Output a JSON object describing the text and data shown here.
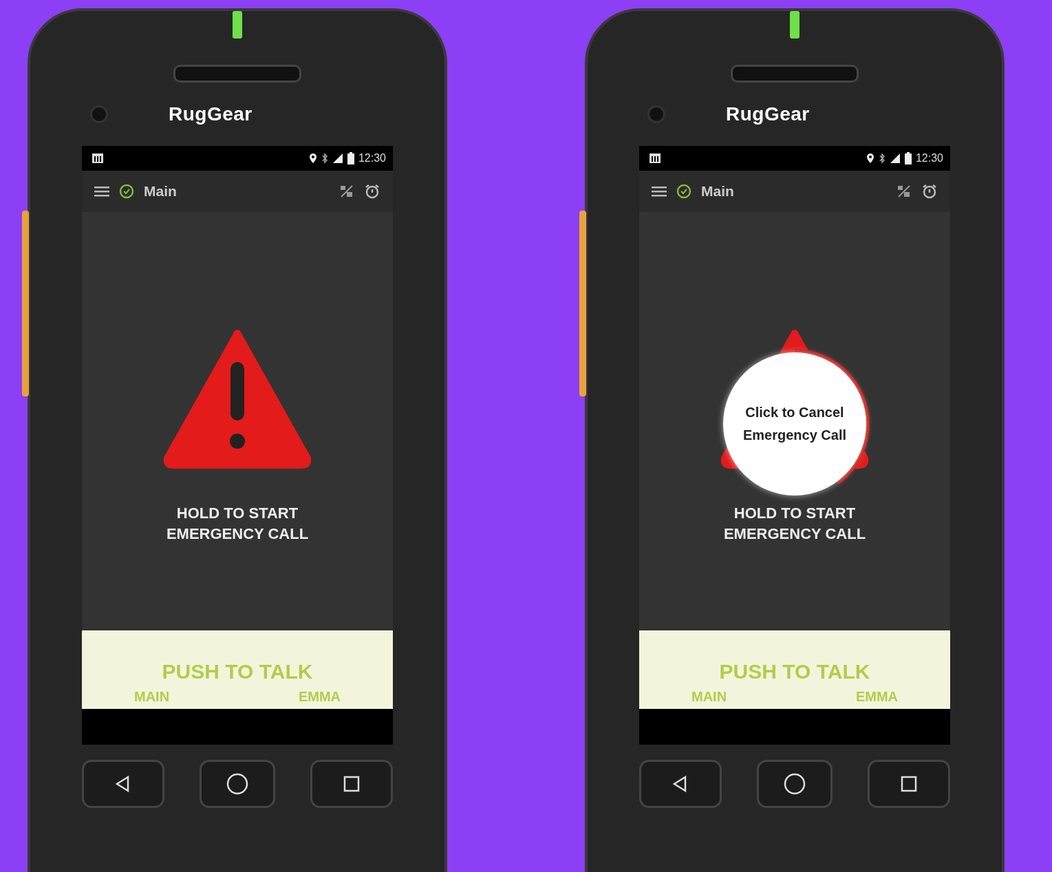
{
  "phones": [
    {
      "brand": "RugGear",
      "status_time": "12:30",
      "title": "Main",
      "emergency_lines": [
        "HOLD TO START",
        "EMERGENCY CALL"
      ],
      "ptt": {
        "label": "PUSH TO TALK",
        "left": "MAIN",
        "right": "EMMA"
      }
    },
    {
      "brand": "RugGear",
      "status_time": "12:30",
      "title": "Main",
      "emergency_lines": [
        "HOLD TO START",
        "EMERGENCY CALL"
      ],
      "cancel_overlay": {
        "lines": [
          "Click to Cancel",
          "Emergency Call"
        ]
      },
      "ptt": {
        "label": "PUSH TO TALK",
        "left": "MAIN",
        "right": "EMMA"
      }
    }
  ]
}
